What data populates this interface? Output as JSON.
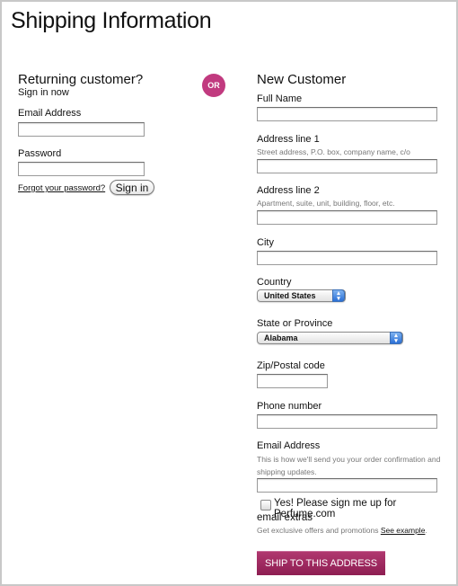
{
  "page": {
    "title": "Shipping Information"
  },
  "returning": {
    "heading": "Returning customer?",
    "subheading": "Sign in now",
    "email_label": "Email Address",
    "email_value": "",
    "password_label": "Password",
    "password_value": "",
    "forgot_link": "Forgot your password?",
    "signin_button": "Sign in"
  },
  "divider": {
    "or_label": "OR",
    "color": "#c13a7f"
  },
  "new_customer": {
    "heading": "New Customer",
    "full_name": {
      "label": "Full Name",
      "value": ""
    },
    "address1": {
      "label": "Address line 1",
      "hint": "Street address, P.O. box, company name, c/o",
      "value": ""
    },
    "address2": {
      "label": "Address line 2",
      "hint": "Apartment, suite, unit, building, floor, etc.",
      "value": ""
    },
    "city": {
      "label": "City",
      "value": ""
    },
    "country": {
      "label": "Country",
      "selected": "United States"
    },
    "state": {
      "label": "State or Province",
      "selected": "Alabama"
    },
    "zip": {
      "label": "Zip/Postal code",
      "value": ""
    },
    "phone": {
      "label": "Phone number",
      "value": ""
    },
    "email": {
      "label": "Email Address",
      "hint_line1": "This is how we'll send you your order confirmation and",
      "hint_line2": "shipping updates.",
      "value": ""
    },
    "newsletter": {
      "checked": false,
      "label_line1": "Yes! Please sign me up for Perfume.com",
      "label_line2": "email extras",
      "promo_text": "Get exclusive offers and promotions ",
      "promo_link": "See example",
      "promo_suffix": "."
    },
    "submit_button": "SHIP TO THIS ADDRESS",
    "submit_color": "#9e2a5f"
  }
}
